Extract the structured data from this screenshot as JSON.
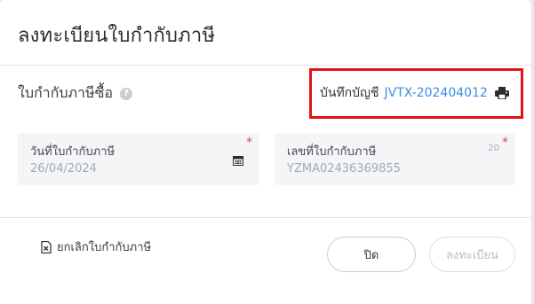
{
  "dialog": {
    "title": "ลงทะเบียนใบกำกับภาษี"
  },
  "section": {
    "title": "ใบกำกับภาษีซื้อ",
    "help_icon": "question-circle-icon"
  },
  "account": {
    "label": "บันทึกบัญชี",
    "link": "JVTX-202404012",
    "print_icon": "printer-icon"
  },
  "fields": {
    "invoice_date": {
      "label": "วันที่ใบกำกับภาษี",
      "value": "26/04/2024",
      "required": "*",
      "icon": "calendar-icon"
    },
    "invoice_number": {
      "label": "เลขที่ใบกำกับภาษี",
      "value": "YZMA02436369855",
      "required": "*",
      "counter": "20"
    }
  },
  "footer": {
    "cancel_invoice_label": "ยกเลิกใบกำกับภาษี",
    "cancel_icon": "document-x-icon",
    "close_button": "ปิด",
    "register_button": "ลงทะเบียน"
  },
  "colors": {
    "link": "#3a8ee6",
    "highlight": "#e0131b",
    "required": "#e8483b"
  }
}
